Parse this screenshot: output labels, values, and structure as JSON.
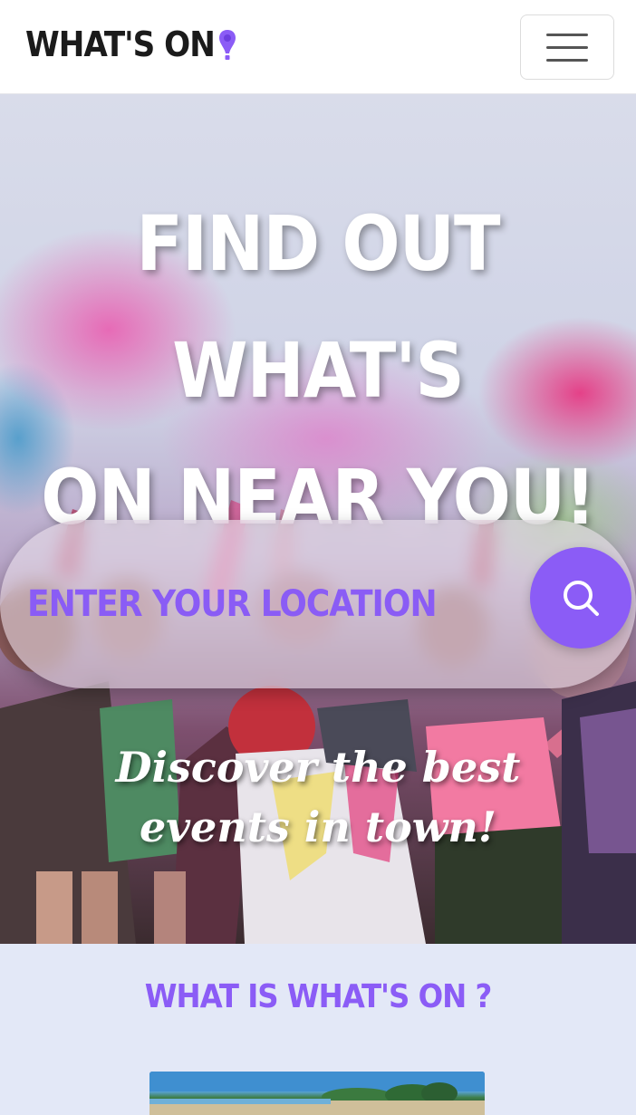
{
  "header": {
    "logo_text": "WHAT'S ON",
    "logo_icon": "map-pin-icon",
    "menu_icon": "hamburger-menu-icon"
  },
  "hero": {
    "title_line1": "FIND OUT WHAT'S",
    "title_line2": "ON NEAR YOU!",
    "search_placeholder": "ENTER YOUR LOCATION",
    "search_icon": "search-icon",
    "tagline": "Discover the best events in town!"
  },
  "about": {
    "title": "WHAT IS WHAT'S ON ?"
  },
  "colors": {
    "accent": "#8b5cf6",
    "header_bg": "#ffffff",
    "section_bg": "#e3e8f7",
    "logo_text": "#1b1b1b"
  }
}
